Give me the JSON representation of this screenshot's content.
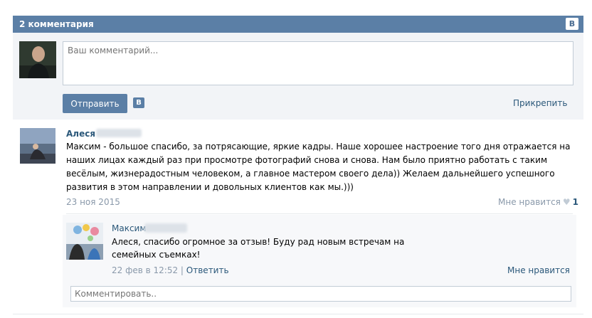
{
  "header": {
    "title": "2 комментария",
    "vk_badge": "В"
  },
  "composer": {
    "placeholder": "Ваш комментарий...",
    "send_label": "Отправить",
    "vk_badge": "В",
    "attach_label": "Прикрепить"
  },
  "comments": [
    {
      "author": "Алеся",
      "text": "Максим - большое спасибо, за потрясающие, яркие кадры. Наше хорошее настроение того дня отражается на наших лицах каждый раз при просмотре фотографий снова и снова. Нам было приятно работать с таким весёлым, жизнерадостным человеком, а главное мастером своего дела)) Желаем дальнейшего успешного развития в этом направлении и довольных клиентов как мы.)))",
      "date": "23 ноя 2015",
      "like_label": "Мне нравится",
      "like_count": "1",
      "replies": [
        {
          "author": "Максим",
          "text": "Алеся, спасибо огромное за отзыв! Буду рад новым встречам на семейных съемках!",
          "date": "22 фев в 12:52",
          "separator": "|",
          "reply_label": "Ответить",
          "like_label": "Мне нравится"
        }
      ],
      "reply_placeholder": "Комментировать.."
    }
  ]
}
